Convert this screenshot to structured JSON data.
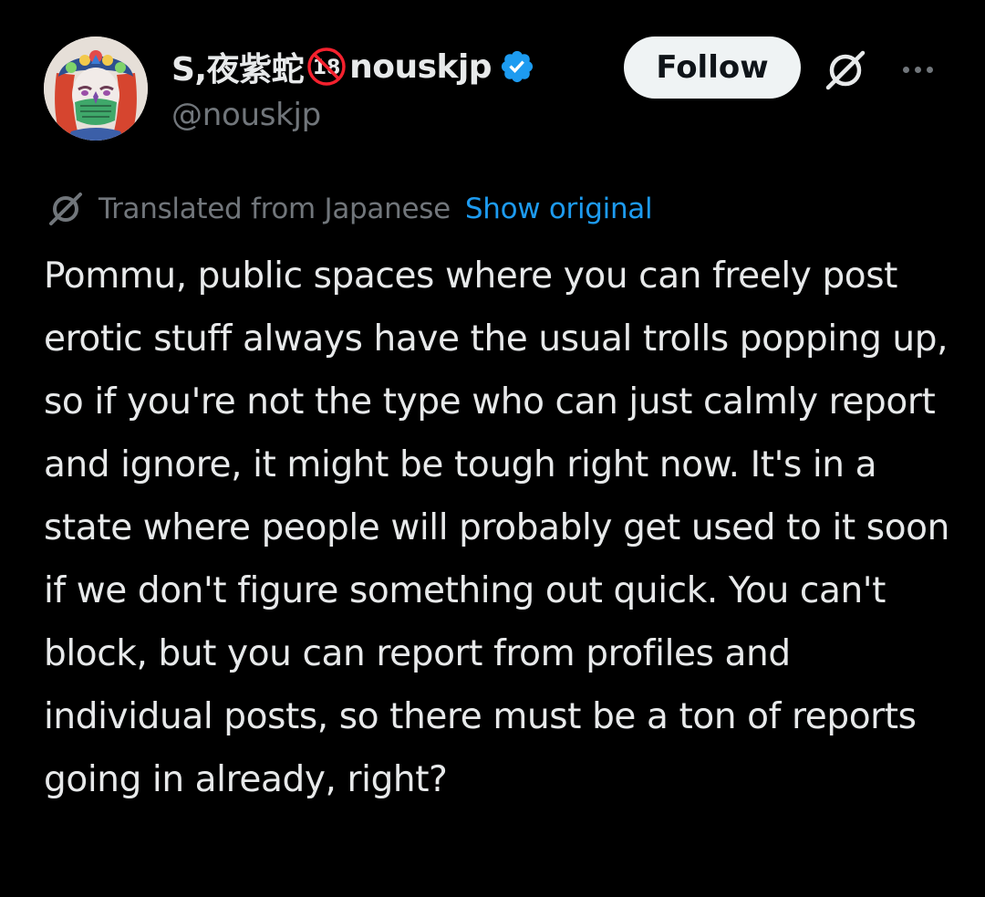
{
  "author": {
    "name_prefix": "S,夜紫蛇",
    "age_badge_text": "18",
    "name_suffix": "nouskjp",
    "handle": "@nouskjp",
    "verified": true
  },
  "actions": {
    "follow_label": "Follow",
    "grok_icon": "grok-icon",
    "more_icon": "more-icon"
  },
  "translation": {
    "label": "Translated from Japanese",
    "show_original_label": "Show original"
  },
  "post": {
    "text": "Pommu, public spaces where you can freely post erotic stuff always have the usual trolls popping up, so if you're not the type who can just calmly report and ignore, it might be tough right now. It's in a state where people will probably get used to it soon if we don't figure something out quick. You can't block, but you can report from profiles and individual posts, so there must be a ton of reports going in already, right?"
  },
  "colors": {
    "background": "#000000",
    "primary_text": "#e7e9ea",
    "secondary_text": "#71767b",
    "link": "#1d9bf0",
    "follow_bg": "#eff3f4",
    "follow_text": "#0f1419",
    "verified_blue": "#1d9bf0",
    "age_badge_red": "#f4212e"
  }
}
